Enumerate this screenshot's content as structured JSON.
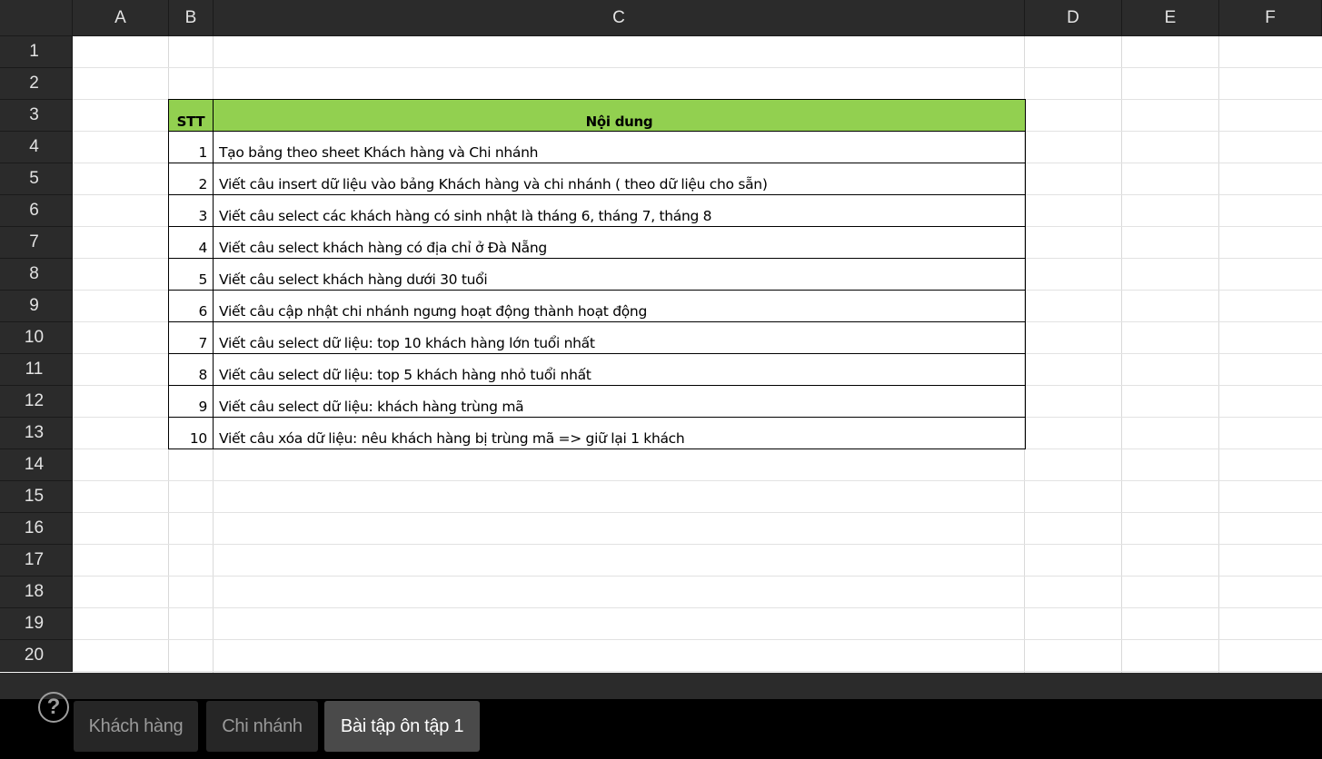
{
  "columns": [
    "A",
    "B",
    "C",
    "D",
    "E",
    "F"
  ],
  "rows": [
    "1",
    "2",
    "3",
    "4",
    "5",
    "6",
    "7",
    "8",
    "9",
    "10",
    "11",
    "12",
    "13",
    "14",
    "15",
    "16",
    "17",
    "18",
    "19",
    "20"
  ],
  "table": {
    "header_stt": "STT",
    "header_content": "Nội dung",
    "header_color": "#92d050",
    "items": [
      {
        "stt": "1",
        "text": "Tạo bảng theo sheet Khách hàng và Chi nhánh"
      },
      {
        "stt": "2",
        "text": "Viết câu insert dữ liệu vào bảng Khách hàng và chi nhánh ( theo dữ liệu cho sẵn)"
      },
      {
        "stt": "3",
        "text": "Viết câu select các khách hàng có sinh nhật là tháng 6, tháng 7, tháng 8"
      },
      {
        "stt": "4",
        "text": "Viết câu select khách hàng có địa chỉ ở Đà Nẵng"
      },
      {
        "stt": "5",
        "text": "Viết câu select khách hàng dưới 30 tuổi"
      },
      {
        "stt": "6",
        "text": "Viết câu cập nhật chi nhánh ngưng hoạt động thành hoạt động"
      },
      {
        "stt": "7",
        "text": "Viết câu select dữ liệu: top 10 khách hàng lớn tuổi nhất"
      },
      {
        "stt": "8",
        "text": "Viết câu select dữ liệu: top 5 khách hàng nhỏ tuổi nhất"
      },
      {
        "stt": "9",
        "text": "Viết câu select dữ liệu: khách hàng trùng mã"
      },
      {
        "stt": "10",
        "text": "Viết câu xóa dữ liệu: nêu khách hàng bị trùng mã => giữ lại 1 khách"
      }
    ]
  },
  "sheet_tabs": [
    {
      "label": "Khách hàng",
      "active": false
    },
    {
      "label": "Chi nhánh",
      "active": false
    },
    {
      "label": "Bài tập ôn tập 1",
      "active": true
    }
  ],
  "icons": {
    "help": "help-icon"
  }
}
